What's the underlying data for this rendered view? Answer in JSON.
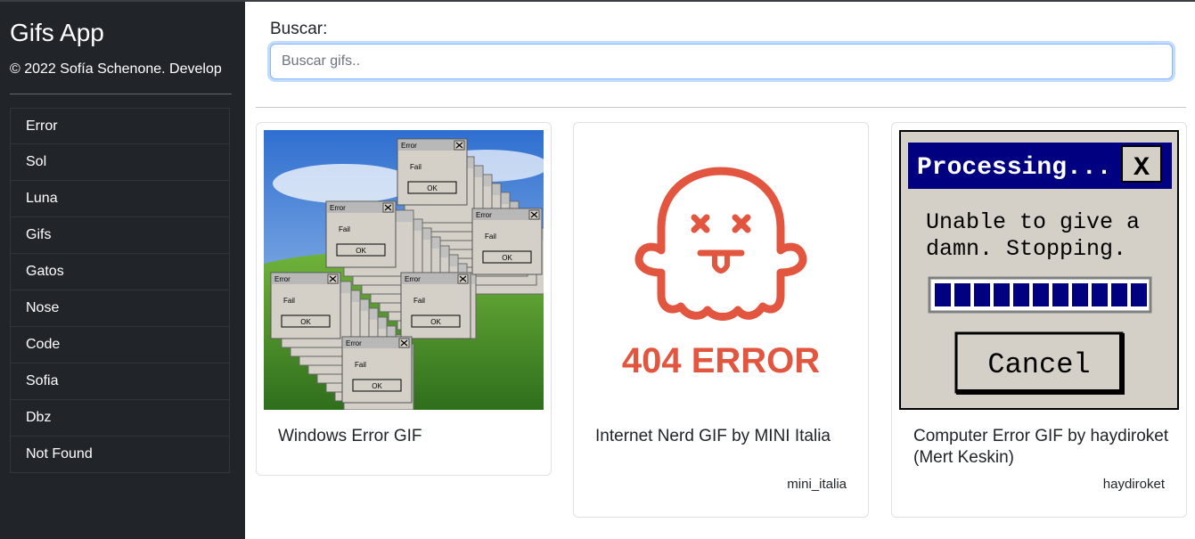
{
  "sidebar": {
    "title": "Gifs App",
    "credit": "© 2022 Sofía Schenone. Develop",
    "items": [
      {
        "label": "Error"
      },
      {
        "label": "Sol"
      },
      {
        "label": "Luna"
      },
      {
        "label": "Gifs"
      },
      {
        "label": "Gatos"
      },
      {
        "label": "Nose"
      },
      {
        "label": "Code"
      },
      {
        "label": "Sofia"
      },
      {
        "label": "Dbz"
      },
      {
        "label": "Not Found"
      }
    ]
  },
  "search": {
    "label": "Buscar:",
    "placeholder": "Buscar gifs..",
    "value": ""
  },
  "cards": [
    {
      "title": "Windows Error GIF",
      "user": "",
      "image": {
        "dialog_title": "Error",
        "dialog_text": "Fail",
        "button": "OK"
      }
    },
    {
      "title": "Internet Nerd GIF by MINI Italia",
      "user": "mini_italia",
      "image": {
        "caption": "404 ERROR"
      }
    },
    {
      "title": "Computer Error GIF by haydiroket (Mert Keskin)",
      "user": "haydiroket",
      "image": {
        "window_title": "Processing...",
        "message_line1": "Unable to give a",
        "message_line2": "damn. Stopping.",
        "button": "Cancel",
        "close_glyph": "X",
        "progress": 1.0
      }
    }
  ],
  "colors": {
    "sidebar_bg": "#212529",
    "accent_focus": "#86b7fe",
    "ghost_red": "#e2553f",
    "win_blue": "#000080"
  }
}
